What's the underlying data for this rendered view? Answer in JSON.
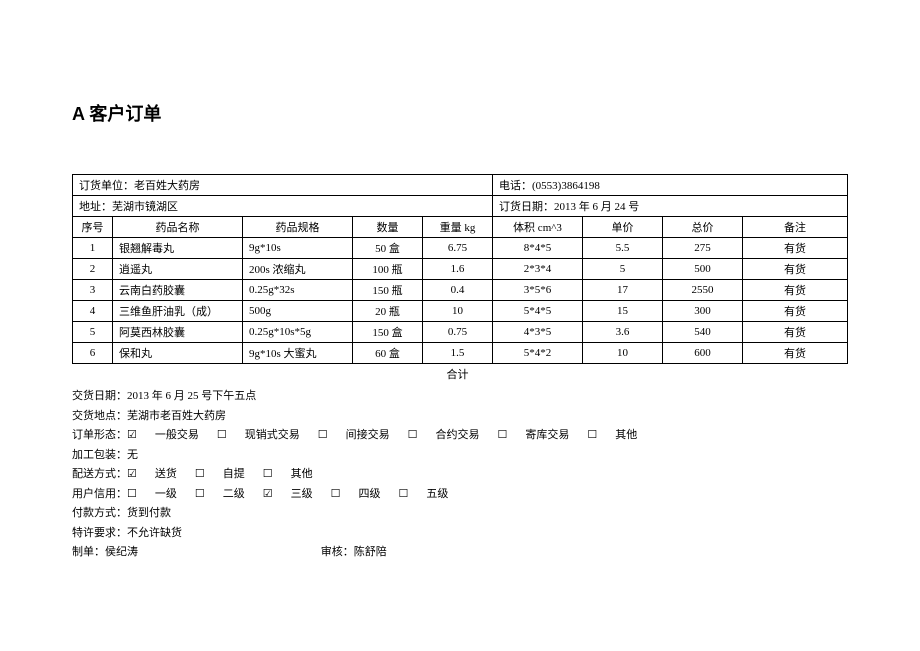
{
  "title": "A 客户订单",
  "header": {
    "order_unit_label": "订货单位：",
    "order_unit": "老百姓大药房",
    "phone_label": "电话：",
    "phone": "(0553)3864198",
    "address_label": "地址：",
    "address": "芜湖市镜湖区",
    "order_date_label": "订货日期：",
    "order_date": "2013 年 6 月 24 号"
  },
  "columns": {
    "seq": "序号",
    "name": "药品名称",
    "spec": "药品规格",
    "qty": "数量",
    "weight": "重量 kg",
    "volume": "体积 cm^3",
    "unit_price": "单价",
    "total_price": "总价",
    "remark": "备注"
  },
  "items": [
    {
      "seq": "1",
      "name": "银翘解毒丸",
      "spec": "9g*10s",
      "qty": "50 盒",
      "weight": "6.75",
      "volume": "8*4*5",
      "unit_price": "5.5",
      "total_price": "275",
      "remark": "有货"
    },
    {
      "seq": "2",
      "name": "逍遥丸",
      "spec": "200s 浓缩丸",
      "qty": "100 瓶",
      "weight": "1.6",
      "volume": "2*3*4",
      "unit_price": "5",
      "total_price": "500",
      "remark": "有货"
    },
    {
      "seq": "3",
      "name": "云南白药胶囊",
      "spec": "0.25g*32s",
      "qty": "150 瓶",
      "weight": "0.4",
      "volume": "3*5*6",
      "unit_price": "17",
      "total_price": "2550",
      "remark": "有货"
    },
    {
      "seq": "4",
      "name": "三维鱼肝油乳（成）",
      "spec": "500g",
      "qty": "20 瓶",
      "weight": "10",
      "volume": "5*4*5",
      "unit_price": "15",
      "total_price": "300",
      "remark": "有货"
    },
    {
      "seq": "5",
      "name": "阿莫西林胶囊",
      "spec": "0.25g*10s*5g",
      "qty": "150 盒",
      "weight": "0.75",
      "volume": "4*3*5",
      "unit_price": "3.6",
      "total_price": "540",
      "remark": "有货"
    },
    {
      "seq": "6",
      "name": "保和丸",
      "spec": "9g*10s 大蜜丸",
      "qty": "60 盒",
      "weight": "1.5",
      "volume": "5*4*2",
      "unit_price": "10",
      "total_price": "600",
      "remark": "有货"
    }
  ],
  "total_label": "合计",
  "footer": {
    "delivery_date": "交货日期：2013 年 6 月 25 号下午五点",
    "delivery_place": "交货地点：芜湖市老百姓大药房",
    "order_form_label": "订单形态：",
    "order_form_options": [
      {
        "label": "一般交易",
        "checked": true
      },
      {
        "label": "现销式交易",
        "checked": false
      },
      {
        "label": "间接交易",
        "checked": false
      },
      {
        "label": "合约交易",
        "checked": false
      },
      {
        "label": "寄库交易",
        "checked": false
      },
      {
        "label": "其他",
        "checked": false
      }
    ],
    "packaging": "加工包装：无",
    "delivery_method_label": "配送方式：",
    "delivery_method_options": [
      {
        "label": "送货",
        "checked": true
      },
      {
        "label": "自提",
        "checked": false
      },
      {
        "label": "其他",
        "checked": false
      }
    ],
    "credit_label": "用户信用：",
    "credit_options": [
      {
        "label": "一级",
        "checked": false
      },
      {
        "label": "二级",
        "checked": false
      },
      {
        "label": "三级",
        "checked": true
      },
      {
        "label": "四级",
        "checked": false
      },
      {
        "label": "五级",
        "checked": false
      }
    ],
    "payment": "付款方式：货到付款",
    "special": "特许要求：不允许缺货",
    "preparer_label": "制单：",
    "preparer": "侯纪涛",
    "approver_label": "审核：",
    "approver": "陈舒陪"
  },
  "checkbox_checked": "☑",
  "checkbox_unchecked": "☐"
}
